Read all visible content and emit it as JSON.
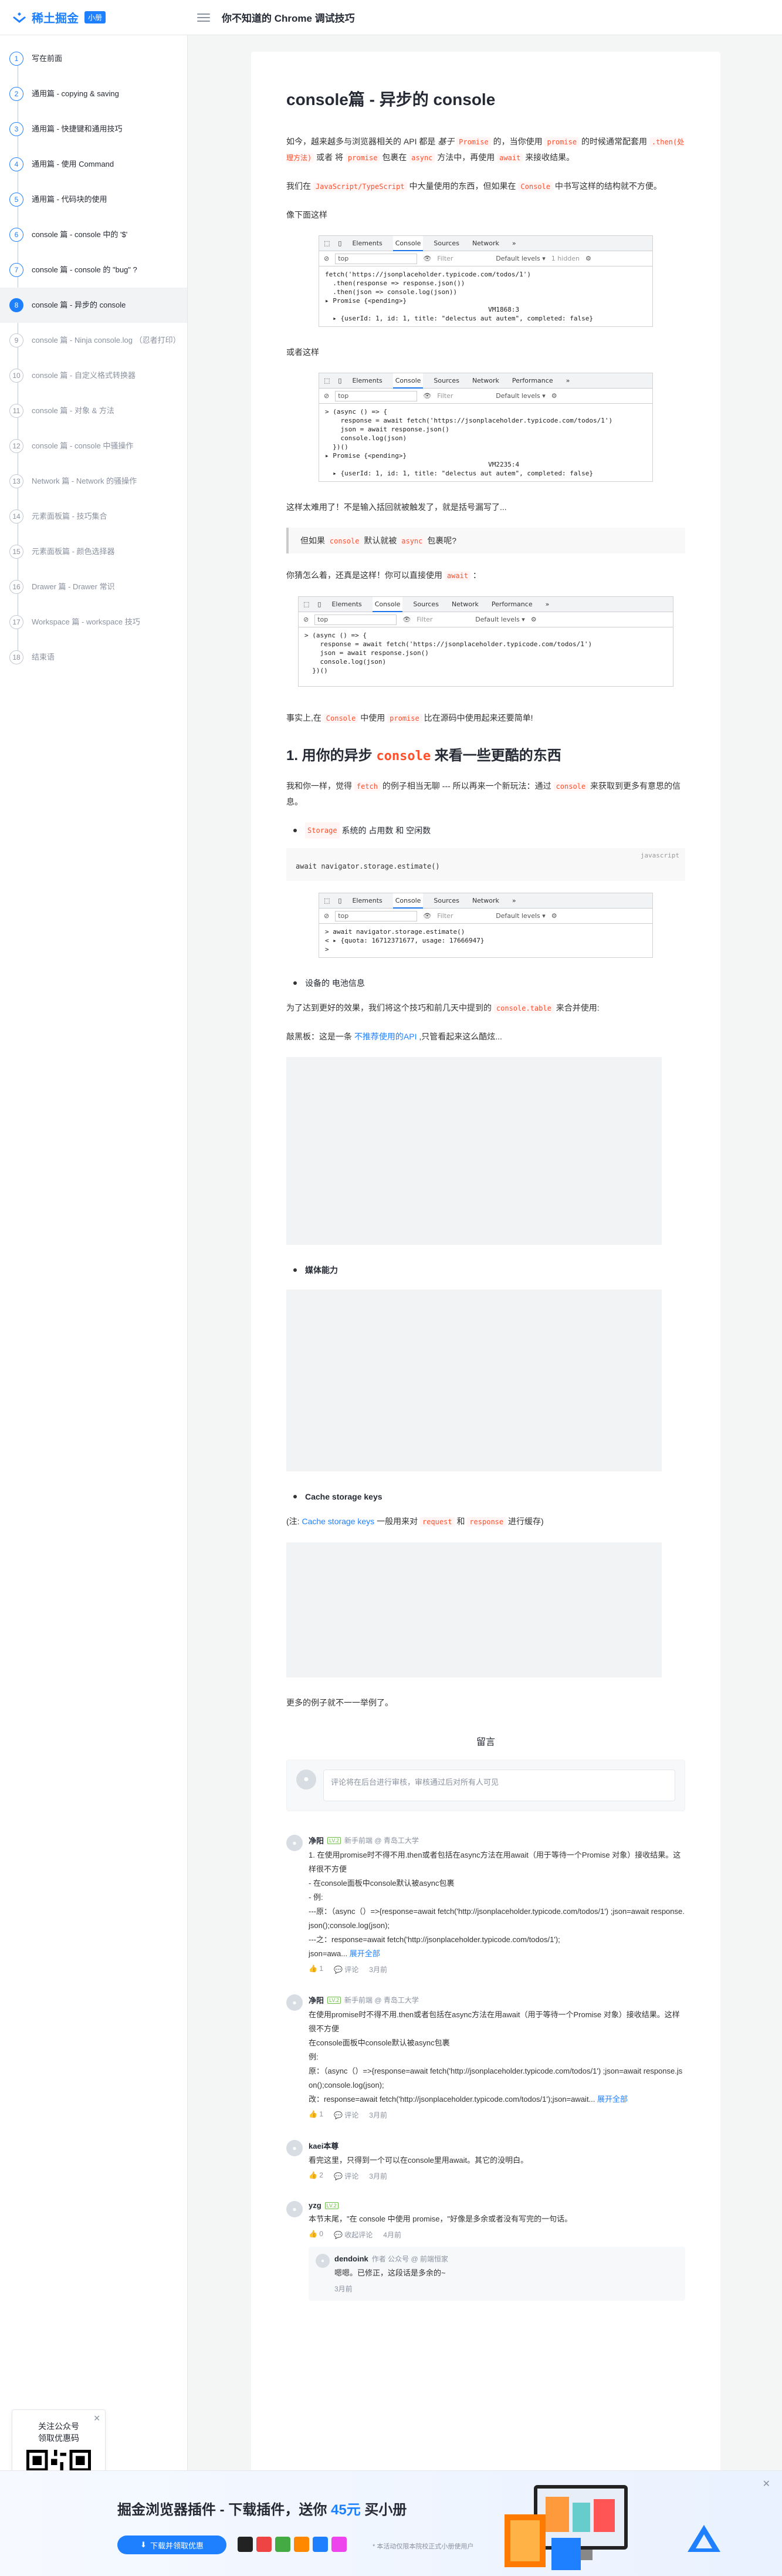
{
  "header": {
    "logo_text": "稀土掘金",
    "badge": "小册",
    "title": "你不知道的 Chrome 调试技巧"
  },
  "toc": [
    {
      "num": "1",
      "label": "写在前面",
      "state": "done"
    },
    {
      "num": "2",
      "label": "通用篇 - copying & saving",
      "state": "done"
    },
    {
      "num": "3",
      "label": "通用篇 - 快捷键和通用技巧",
      "state": "done"
    },
    {
      "num": "4",
      "label": "通用篇 - 使用 Command",
      "state": "done"
    },
    {
      "num": "5",
      "label": "通用篇 - 代码块的使用",
      "state": "done"
    },
    {
      "num": "6",
      "label": "console 篇 - console 中的 '$'",
      "state": "done"
    },
    {
      "num": "7",
      "label": "console 篇 - console 的 \"bug\" ?",
      "state": "done"
    },
    {
      "num": "8",
      "label": "console 篇 - 异步的 console",
      "state": "active"
    },
    {
      "num": "9",
      "label": "console 篇 - Ninja console.log （忍者打印）",
      "state": "locked"
    },
    {
      "num": "10",
      "label": "console 篇 - 自定义格式转换器",
      "state": "locked"
    },
    {
      "num": "11",
      "label": "console 篇 - 对象 & 方法",
      "state": "locked"
    },
    {
      "num": "12",
      "label": "console 篇 - console 中骚操作",
      "state": "locked"
    },
    {
      "num": "13",
      "label": "Network 篇 - Network 的骚操作",
      "state": "locked"
    },
    {
      "num": "14",
      "label": "元素面板篇 - 技巧集合",
      "state": "locked"
    },
    {
      "num": "15",
      "label": "元素面板篇 - 颜色选择器",
      "state": "locked"
    },
    {
      "num": "16",
      "label": "Drawer 篇 - Drawer 常识",
      "state": "locked"
    },
    {
      "num": "17",
      "label": "Workspace 篇 - workspace 技巧",
      "state": "locked"
    },
    {
      "num": "18",
      "label": "结束语",
      "state": "locked"
    }
  ],
  "qr": {
    "line1": "关注公众号",
    "line2": "领取优惠码"
  },
  "article": {
    "title": "console篇 - 异步的 console",
    "p1_a": "如今，越来越多与浏览器相关的 API 都是",
    "p1_b": "基于",
    "p1_c": "Promise",
    "p1_d": "的，当你使用",
    "p1_e": "promise",
    "p1_f": "的时候通常配套用",
    "p1_g": ".then(处理方法)",
    "p1_h": "或者 将",
    "p1_i": "promise",
    "p1_j": "包裹在",
    "p1_k": "async",
    "p1_l": "方法中，再使用",
    "p1_m": "await",
    "p1_n": "来接收结果。",
    "p2_a": "我们在",
    "p2_b": "JavaScript/TypeScript",
    "p2_c": "中大量使用的东西，但如果在",
    "p2_d": "Console",
    "p2_e": "中书写这样的结构就不方便。",
    "p3": "像下面这样",
    "p4": "或者这样",
    "p5": "这样太难用了！不是输入括回就被触发了，就是括号漏写了...",
    "quote_a": "但如果",
    "quote_b": "console",
    "quote_c": "默认就被",
    "quote_d": "async",
    "quote_e": "包裹呢?",
    "p6_a": "你猜怎么着，还真是这样！你可以直接使用",
    "p6_b": "await",
    "p6_c": "：",
    "p7_a": "事实上,在",
    "p7_b": "Console",
    "p7_c": "中使用",
    "p7_d": "promise",
    "p7_e": "比在源码中使用起来还要简单!",
    "h2_a": "1. 用你的异步",
    "h2_b": "console",
    "h2_c": "来看一些更酷的东西",
    "p8_a": "我和你一样，觉得",
    "p8_b": "fetch",
    "p8_c": "的例子相当无聊 --- 所以再来一个新玩法：通过",
    "p8_d": "console",
    "p8_e": "来获取到更多有意思的信息。",
    "li1_a": "Storage",
    "li1_b": "系统的 占用数 和 空闲数",
    "code1": "await navigator.storage.estimate()",
    "code1_lang": "javascript",
    "li2": "设备的 电池信息",
    "p9_a": "为了达到更好的效果，我们将这个技巧和前几天中提到的",
    "p9_b": "console.table",
    "p9_c": "来合并使用:",
    "p10_a": "敲黑板：这是一条",
    "p10_b": "不推荐使用的API",
    "p10_c": ",只管看起来这么酷炫...",
    "li3": "媒体能力",
    "li4": "Cache storage keys",
    "p11_a": "(注:",
    "p11_b": "Cache storage keys",
    "p11_c": "一般用来对",
    "p11_d": "request",
    "p11_e": "和",
    "p11_f": "response",
    "p11_g": "进行缓存)",
    "p12": "更多的例子就不一一举例了。"
  },
  "devtools": {
    "tabs1": [
      "Elements",
      "Console",
      "Sources",
      "Network",
      "»"
    ],
    "tabs2": [
      "Elements",
      "Console",
      "Sources",
      "Network",
      "Performance",
      "»"
    ],
    "context": "top",
    "filter": "Filter",
    "levels": "Default levels ▾",
    "hidden": "1 hidden",
    "code1": "fetch('https://jsonplaceholder.typicode.com/todos/1')\n  .then(response => response.json())\n  .then(json => console.log(json))\n▸ Promise {<pending>}\n                                          VM1868:3\n  ▸ {userId: 1, id: 1, title: \"delectus aut autem\", completed: false}",
    "code2": "> (async () => {\n    response = await fetch('https://jsonplaceholder.typicode.com/todos/1')\n    json = await response.json()\n    console.log(json)\n  })()\n▸ Promise {<pending>}\n                                          VM2235:4\n  ▸ {userId: 1, id: 1, title: \"delectus aut autem\", completed: false}",
    "code3": "> (async () => {\n    response = await fetch('https://jsonplaceholder.typicode.com/todos/1')\n    json = await response.json()\n    console.log(json)\n  })()",
    "code4": "> await navigator.storage.estimate()\n< ▸ {quota: 16712371677, usage: 17666947}\n> "
  },
  "comments": {
    "header": "留言",
    "placeholder": "评论将在后台进行审核，审核通过后对所有人可见",
    "items": [
      {
        "name": "净阳",
        "level": "LV.2",
        "meta": "新手前端 @ 青岛工大学",
        "text": "1. 在使用promise时不得不用.then或者包括在async方法在用await（用于等待一个Promise 对象）接收结果。这样很不方便\n- 在console面板中console默认被async包裹\n- 例:\n---原：（async（）=>{response=await fetch('http://jsonplaceholder.typicode.com/todos/1') ;json=await response.json();console.log(json);\n---之：response=await fetch('http://jsonplaceholder.typicode.com/todos/1');\njson=awa...",
        "more": "展开全部",
        "likes": "1",
        "reply_label": "评论",
        "time": "3月前"
      },
      {
        "name": "净阳",
        "level": "LV.2",
        "meta": "新手前端 @ 青岛工大学",
        "text": "在使用promise时不得不用.then或者包括在async方法在用await（用于等待一个Promise 对象）接收结果。这样很不方便\n在console面板中console默认被async包裹\n例:\n原：（async（）=>{response=await fetch('http://jsonplaceholder.typicode.com/todos/1') ;json=await response.json();console.log(json);\n改：response=await fetch('http://jsonplaceholder.typicode.com/todos/1');json=await...",
        "more": "展开全部",
        "likes": "1",
        "reply_label": "评论",
        "time": "3月前"
      },
      {
        "name": "kaei本尊",
        "level": "",
        "meta": "",
        "text": "看完这里，只得到一个可以在console里用await。其它的没明白。",
        "more": "",
        "likes": "2",
        "reply_label": "评论",
        "time": "3月前"
      },
      {
        "name": "yzg",
        "level": "LV.2",
        "meta": "",
        "text": "本节末尾，\"在 console 中使用 promise，\"好像是多余或者没有写完的一句话。",
        "more": "",
        "likes": "0",
        "reply_label": "收起评论",
        "time": "4月前"
      }
    ],
    "reply": {
      "name": "dendoink",
      "meta": "作者 公众号 @ 前端恒家",
      "text": "嗯嗯。已修正，这段话是多余的~",
      "time": "3月前"
    }
  },
  "banner": {
    "title_a": "掘金浏览器插件 - 下载插件，送你",
    "price": "45元",
    "title_b": "买小册",
    "button": "下载并领取优惠",
    "note": "* 本活动仅限本院校正式小册使用户"
  }
}
